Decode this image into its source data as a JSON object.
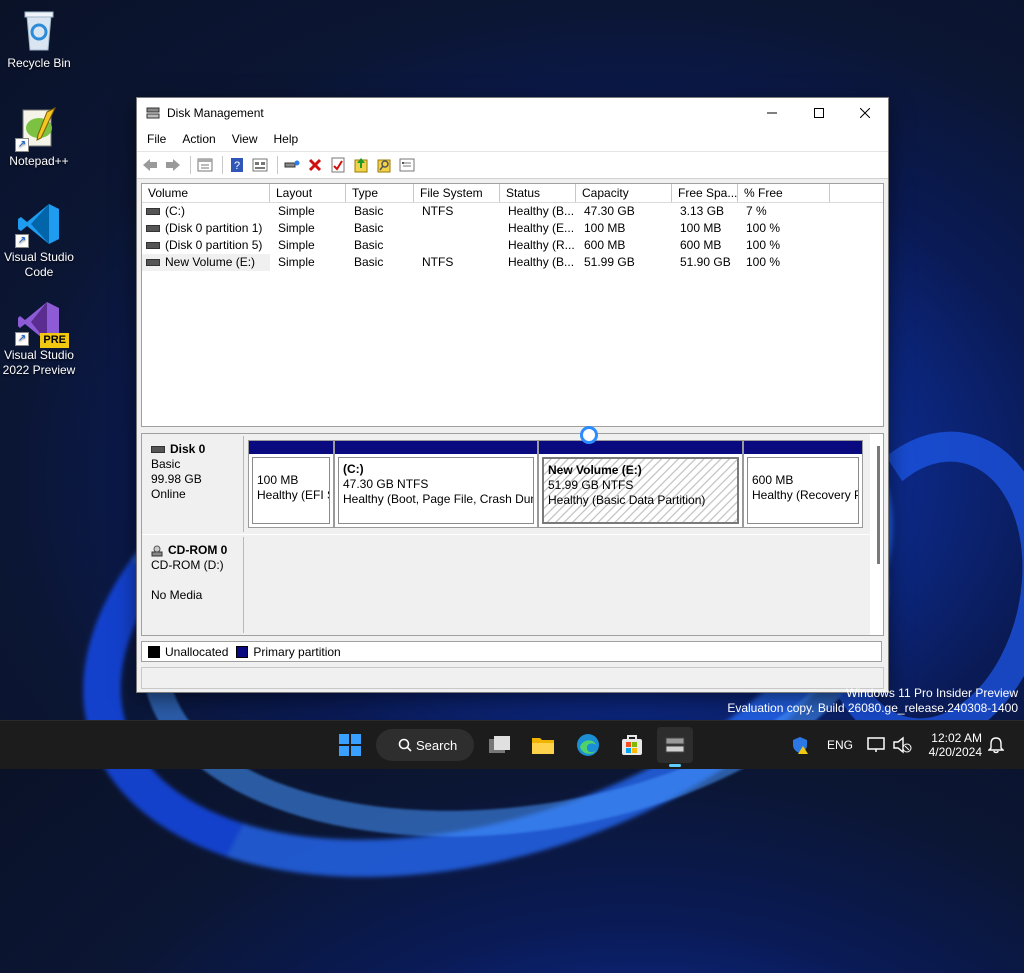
{
  "desktop": {
    "icons": [
      {
        "label": "Recycle Bin"
      },
      {
        "label": "Notepad++"
      },
      {
        "label_line1": "Visual Studio",
        "label_line2": "Code"
      },
      {
        "label_line1": "Visual Studio",
        "label_line2": "2022 Preview",
        "badge": "PRE"
      }
    ]
  },
  "window": {
    "title": "Disk Management",
    "menu": [
      "File",
      "Action",
      "View",
      "Help"
    ],
    "toolbar_icons": [
      "back-icon",
      "forward-icon",
      "properties-icon",
      "help-icon",
      "list-view-icon",
      "connect-icon",
      "delete-icon",
      "check-icon",
      "import-icon",
      "search-icon",
      "settings-icon"
    ]
  },
  "volume_list": {
    "columns": [
      "Volume",
      "Layout",
      "Type",
      "File System",
      "Status",
      "Capacity",
      "Free Spa...",
      "% Free"
    ],
    "rows": [
      [
        "(C:)",
        "Simple",
        "Basic",
        "NTFS",
        "Healthy (B...",
        "47.30 GB",
        "3.13 GB",
        "7 %"
      ],
      [
        "(Disk 0 partition 1)",
        "Simple",
        "Basic",
        "",
        "Healthy (E...",
        "100 MB",
        "100 MB",
        "100 %"
      ],
      [
        "(Disk 0 partition 5)",
        "Simple",
        "Basic",
        "",
        "Healthy (R...",
        "600 MB",
        "600 MB",
        "100 %"
      ],
      [
        "New Volume (E:)",
        "Simple",
        "Basic",
        "NTFS",
        "Healthy (B...",
        "51.99 GB",
        "51.90 GB",
        "100 %"
      ]
    ]
  },
  "disks": {
    "disk0": {
      "name": "Disk 0",
      "type": "Basic",
      "size": "99.98 GB",
      "status": "Online",
      "partitions": [
        {
          "title": "",
          "line1": "100 MB",
          "line2": "Healthy (EFI S"
        },
        {
          "title": "(C:)",
          "line1": "47.30 GB NTFS",
          "line2": "Healthy (Boot, Page File, Crash Dun"
        },
        {
          "title": "New Volume  (E:)",
          "line1": "51.99 GB NTFS",
          "line2": "Healthy (Basic Data Partition)"
        },
        {
          "title": "",
          "line1": "600 MB",
          "line2": "Healthy (Recovery P"
        }
      ]
    },
    "cdrom0": {
      "name": "CD-ROM 0",
      "drive": "CD-ROM (D:)",
      "media": "No Media"
    }
  },
  "legend": {
    "unallocated": "Unallocated",
    "primary": "Primary partition",
    "unallocated_color": "#000000",
    "primary_color": "#0a0a80"
  },
  "watermark": {
    "line1": "Windows 11 Pro Insider Preview",
    "line2": "Evaluation copy. Build 26080.ge_release.240308-1400"
  },
  "taskbar": {
    "search_label": "Search",
    "language": "ENG",
    "time": "12:02 AM",
    "date": "4/20/2024"
  }
}
